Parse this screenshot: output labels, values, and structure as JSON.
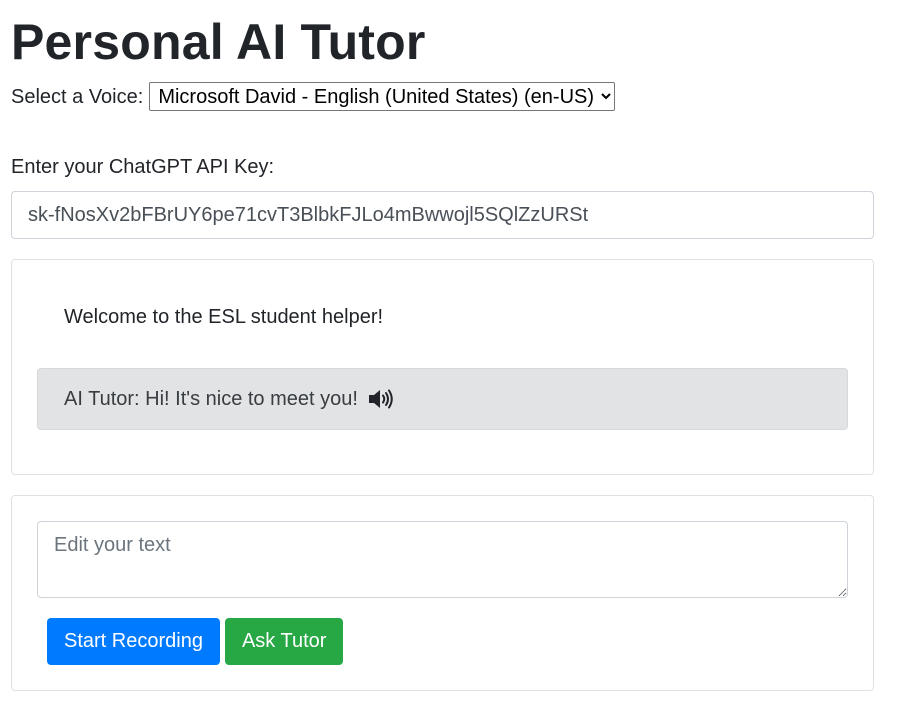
{
  "app": {
    "title": "Personal AI Tutor"
  },
  "voice": {
    "label": "Select a Voice:",
    "selected": "Microsoft David - English (United States) (en-US)"
  },
  "api_key": {
    "label": "Enter your ChatGPT API Key:",
    "value": "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"
  },
  "chat": {
    "welcome": "Welcome to the ESL student helper!",
    "messages": [
      {
        "text": "AI Tutor: Hi! It's nice to meet you!",
        "icon": "speaker-icon"
      }
    ]
  },
  "composer": {
    "placeholder": "Edit your text",
    "record_label": "Start Recording",
    "ask_label": "Ask Tutor"
  },
  "colors": {
    "primary": "#007bff",
    "success": "#28a745",
    "message_bg": "#e2e3e5"
  }
}
